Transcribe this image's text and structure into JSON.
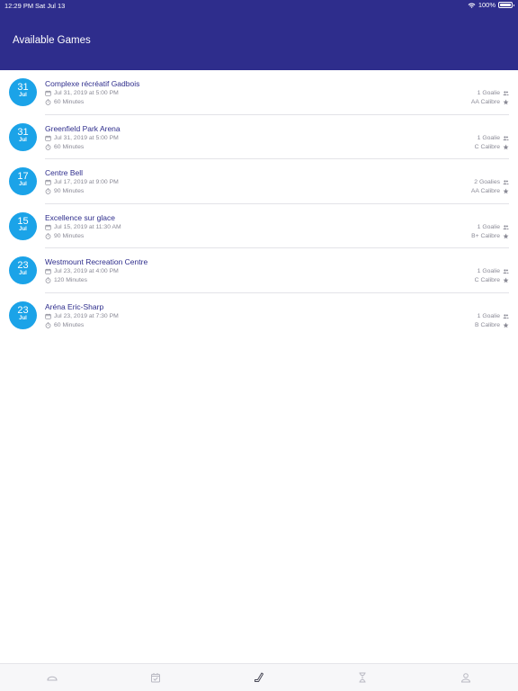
{
  "status": {
    "time": "12:29 PM",
    "date": "Sat Jul 13",
    "battery": "100%"
  },
  "header": {
    "title": "Available Games"
  },
  "games": [
    {
      "day": "31",
      "month": "Jul",
      "venue": "Complexe récréatif Gadbois",
      "datetime": "Jul 31, 2019 at 5:00 PM",
      "duration": "60 Minutes",
      "goalies": "1 Goalie",
      "calibre": "AA Calibre"
    },
    {
      "day": "31",
      "month": "Jul",
      "venue": "Greenfield Park Arena",
      "datetime": "Jul 31, 2019 at 5:00 PM",
      "duration": "60 Minutes",
      "goalies": "1 Goalie",
      "calibre": "C Calibre"
    },
    {
      "day": "17",
      "month": "Jul",
      "venue": "Centre Bell",
      "datetime": "Jul 17, 2019 at 9:00 PM",
      "duration": "90 Minutes",
      "goalies": "2 Goalies",
      "calibre": "AA Calibre"
    },
    {
      "day": "15",
      "month": "Jul",
      "venue": "Excellence sur glace",
      "datetime": "Jul 15, 2019 at 11:30 AM",
      "duration": "90 Minutes",
      "goalies": "1 Goalie",
      "calibre": "B+ Calibre"
    },
    {
      "day": "23",
      "month": "Jul",
      "venue": "Westmount Recreation Centre",
      "datetime": "Jul 23, 2019 at 4:00 PM",
      "duration": "120 Minutes",
      "goalies": "1 Goalie",
      "calibre": "C Calibre"
    },
    {
      "day": "23",
      "month": "Jul",
      "venue": "Aréna Eric-Sharp",
      "datetime": "Jul 23, 2019 at 7:30 PM",
      "duration": "60 Minutes",
      "goalies": "1 Goalie",
      "calibre": "B Calibre"
    }
  ],
  "tabs": [
    {
      "icon": "rink-icon",
      "active": false
    },
    {
      "icon": "calendar-check-icon",
      "active": false
    },
    {
      "icon": "hockey-stick-icon",
      "active": true
    },
    {
      "icon": "hourglass-icon",
      "active": false
    },
    {
      "icon": "profile-icon",
      "active": false
    }
  ],
  "colors": {
    "header": "#2e2d8c",
    "badge": "#1ba3e8",
    "venue_text": "#2e2d8c",
    "meta_text": "#8a8a96",
    "tab_inactive": "#b8b8c2",
    "tab_active": "#4a4a58"
  }
}
